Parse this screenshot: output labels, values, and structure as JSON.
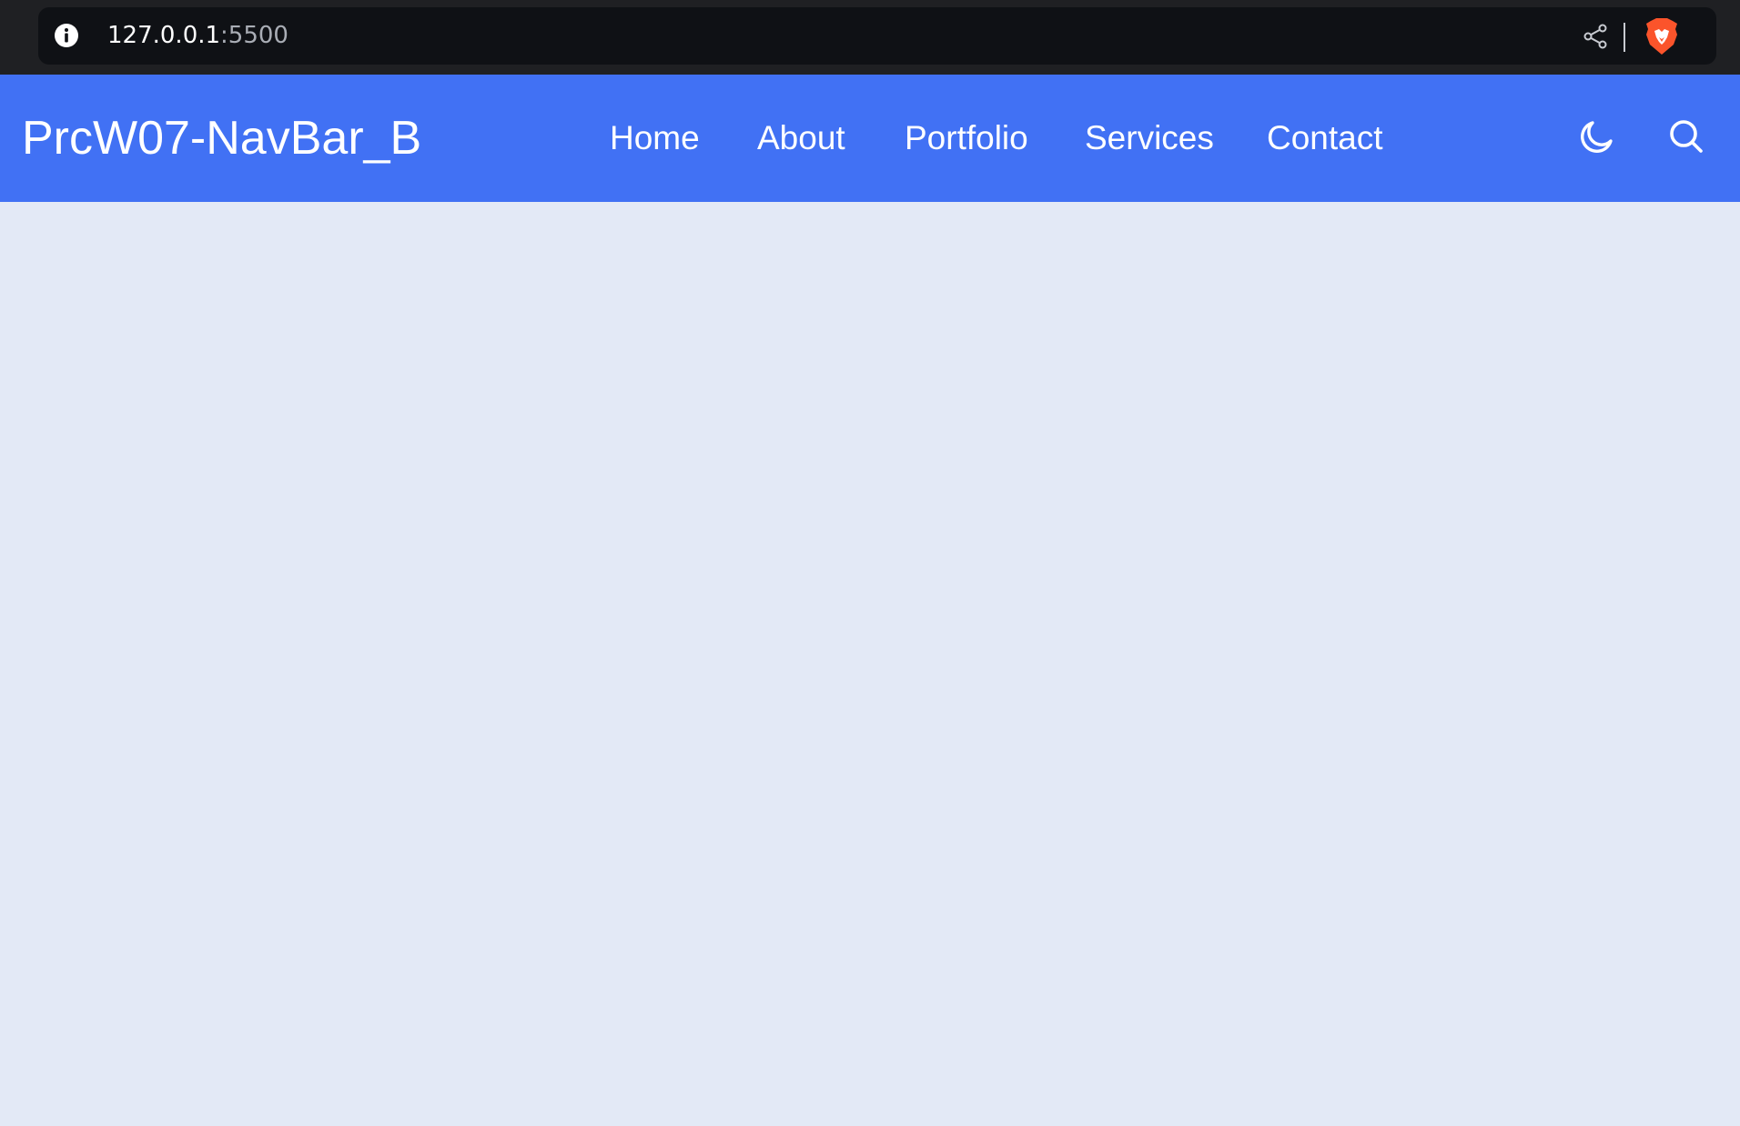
{
  "browser": {
    "url_host": "127.0.0.1",
    "url_port": ":5500",
    "icons": {
      "info": "info-icon",
      "share": "share-icon",
      "brave": "brave-lion-icon"
    }
  },
  "navbar": {
    "logo_text": "PrcW07-NavBar_B",
    "links": [
      {
        "label": "Home"
      },
      {
        "label": "About"
      },
      {
        "label": "Portfolio"
      },
      {
        "label": "Services"
      },
      {
        "label": "Contact"
      }
    ],
    "icons": {
      "theme_toggle": "moon-icon",
      "search": "search-icon"
    }
  },
  "colors": {
    "chrome_background": "#1f2023",
    "url_box_background": "#0f1115",
    "navbar_background": "#4171f4",
    "page_background": "#e3e9f6",
    "brave_orange": "#fb542b"
  }
}
